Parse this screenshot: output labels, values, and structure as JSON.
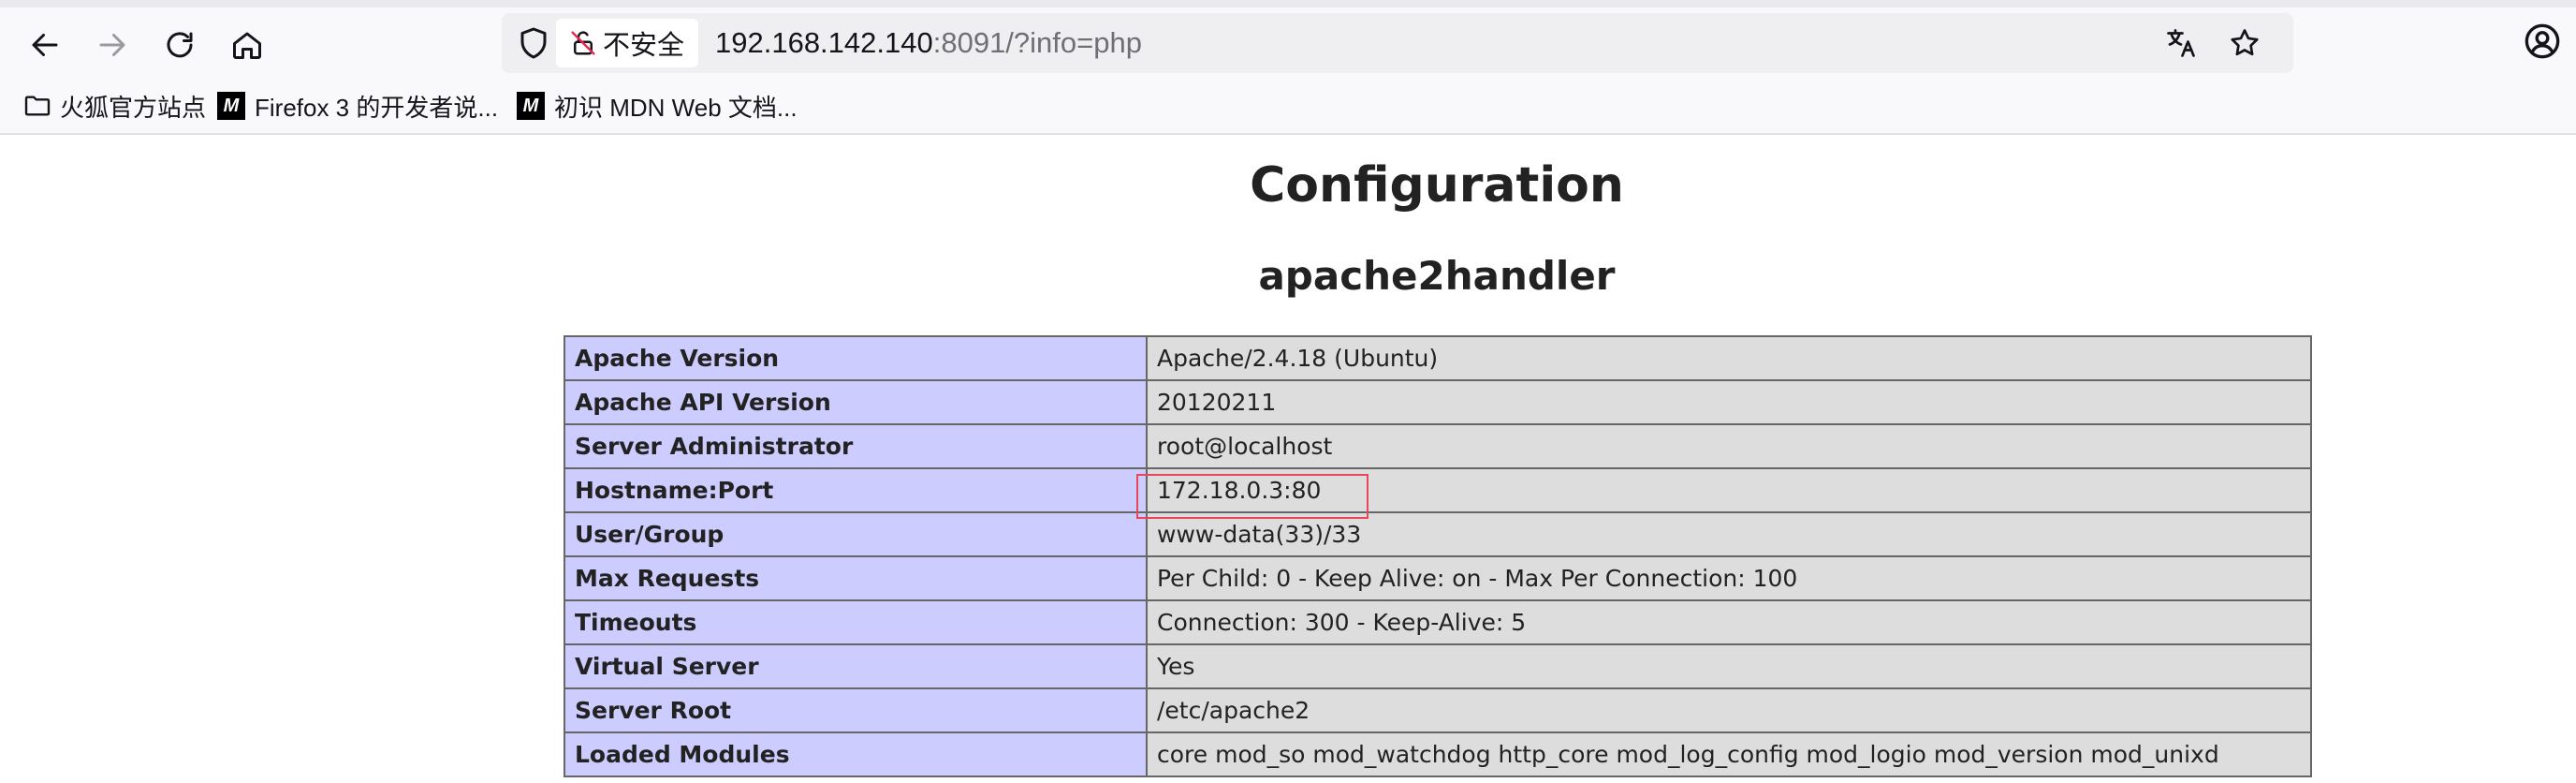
{
  "browser": {
    "security_label": "不安全",
    "url_host": "192.168.142.140",
    "url_rest": ":8091/?info=php",
    "bookmarks": [
      {
        "label": "火狐官方站点",
        "icon": "folder-icon"
      },
      {
        "label": "Firefox 3 的开发者说...",
        "icon": "mdn-icon"
      },
      {
        "label": "初识 MDN Web 文档...",
        "icon": "mdn-icon"
      }
    ],
    "mdn_glyph": "M"
  },
  "page": {
    "title": "Configuration",
    "section": "apache2handler",
    "rows": [
      {
        "key": "Apache Version",
        "value": "Apache/2.4.18 (Ubuntu)"
      },
      {
        "key": "Apache API Version",
        "value": "20120211"
      },
      {
        "key": "Server Administrator",
        "value": "root@localhost"
      },
      {
        "key": "Hostname:Port",
        "value": "172.18.0.3:80"
      },
      {
        "key": "User/Group",
        "value": "www-data(33)/33"
      },
      {
        "key": "Max Requests",
        "value": "Per Child: 0 - Keep Alive: on - Max Per Connection: 100"
      },
      {
        "key": "Timeouts",
        "value": "Connection: 300 - Keep-Alive: 5"
      },
      {
        "key": "Virtual Server",
        "value": "Yes"
      },
      {
        "key": "Server Root",
        "value": "/etc/apache2"
      },
      {
        "key": "Loaded Modules",
        "value": "core mod_so mod_watchdog http_core mod_log_config mod_logio mod_version mod_unixd"
      }
    ]
  },
  "colors": {
    "key_cell": "#ccccff",
    "value_cell": "#dddddd",
    "highlight_border": "#e8465a"
  }
}
